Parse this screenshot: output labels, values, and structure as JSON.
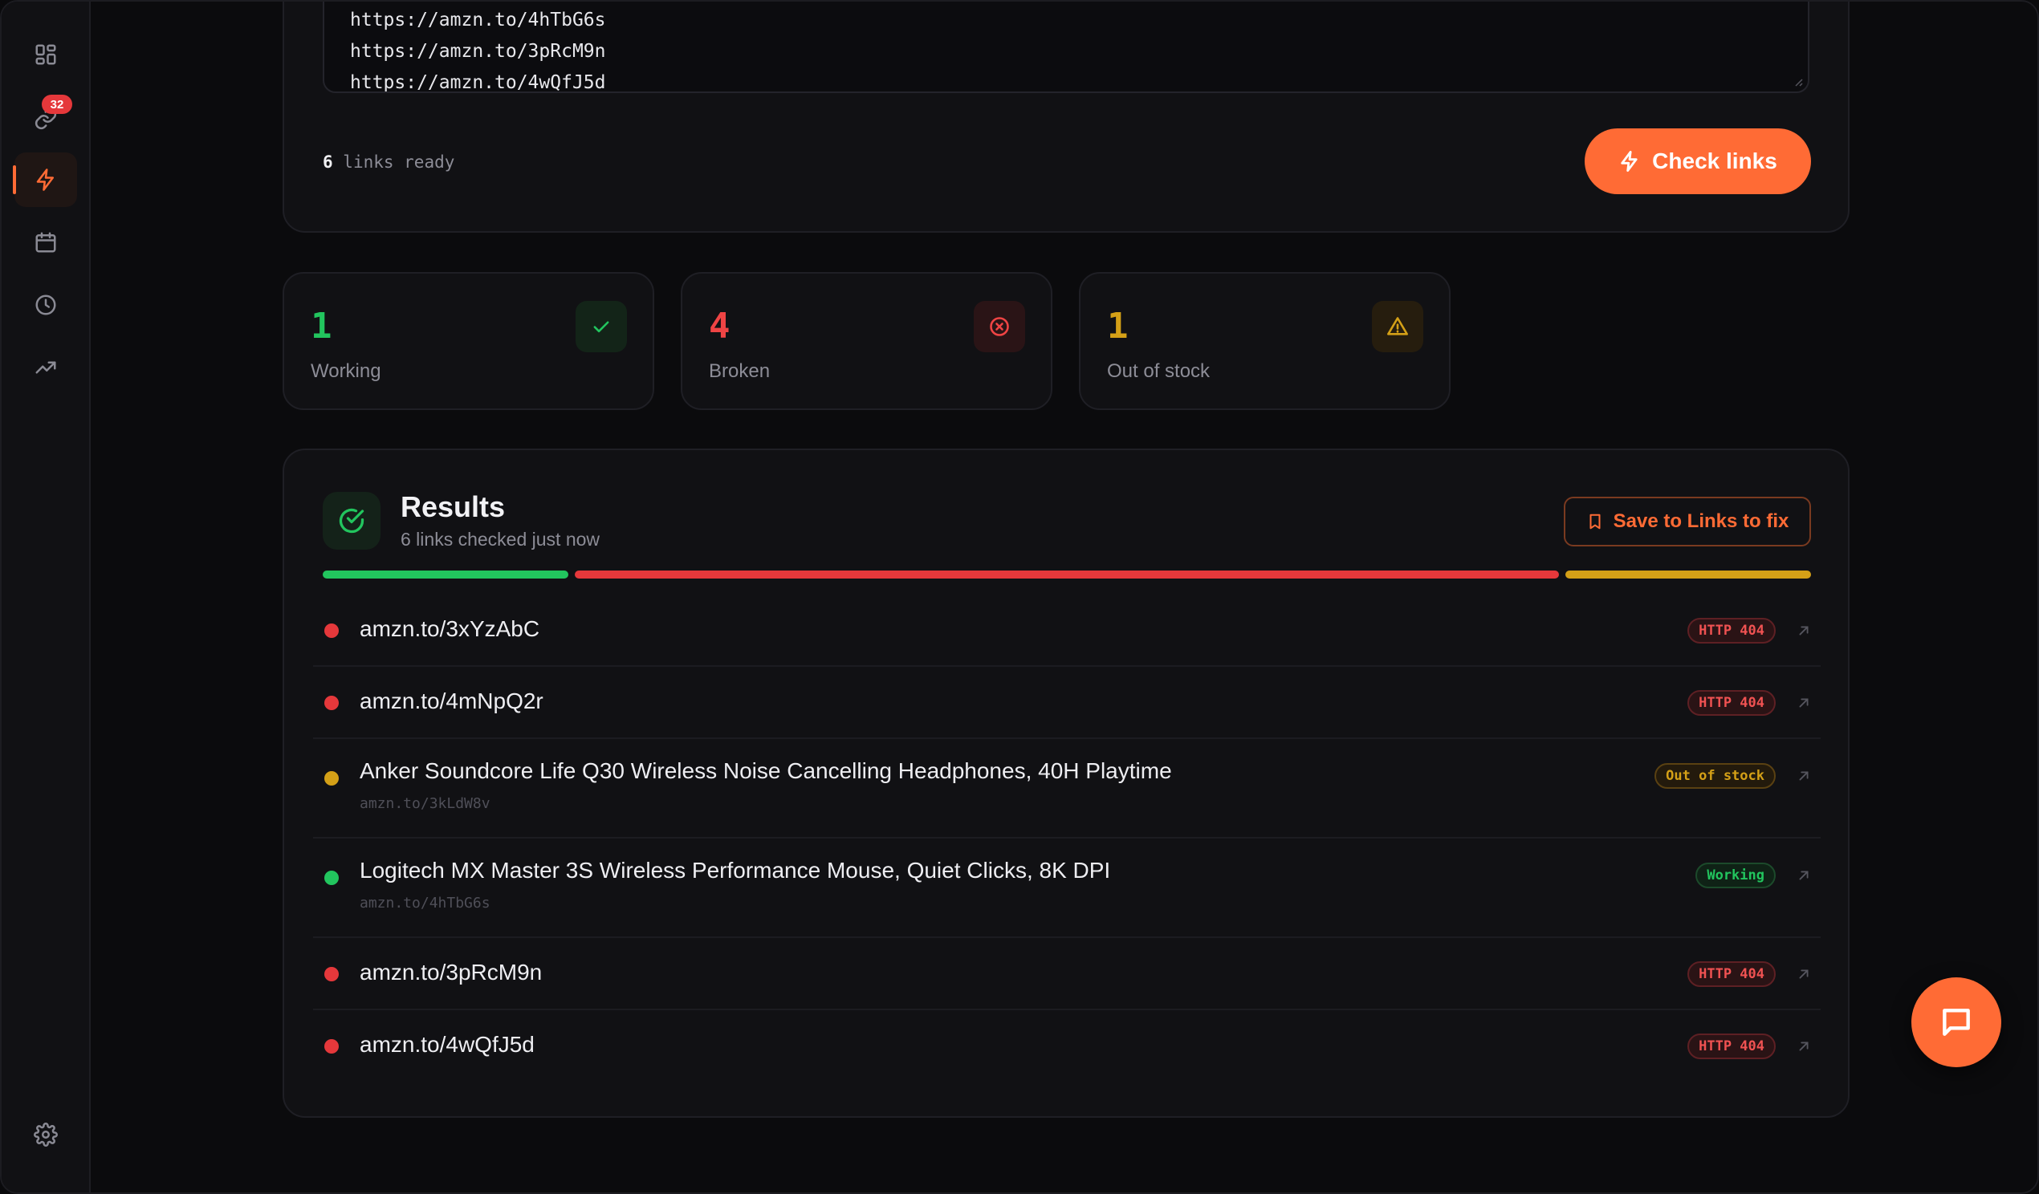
{
  "sidebar": {
    "items": [
      {
        "icon": "dashboard-icon"
      },
      {
        "icon": "link-icon",
        "badge": "32"
      },
      {
        "icon": "lightning-icon",
        "active": true
      },
      {
        "icon": "calendar-icon"
      },
      {
        "icon": "clock-icon"
      },
      {
        "icon": "trending-up-icon"
      }
    ],
    "settings_icon": "gear-icon"
  },
  "input": {
    "lines": [
      "https://amzn.to/4hTbG6s",
      "https://amzn.to/3pRcM9n",
      "https://amzn.to/4wQfJ5d"
    ],
    "count": "6",
    "count_suffix": " links ready",
    "check_button": "Check links"
  },
  "stats": [
    {
      "value": "1",
      "label": "Working",
      "color": "#22c55e",
      "icon": "check-icon"
    },
    {
      "value": "4",
      "label": "Broken",
      "color": "#ef4444",
      "icon": "x-circle-icon"
    },
    {
      "value": "1",
      "label": "Out of stock",
      "color": "#d4a017",
      "icon": "warning-icon"
    }
  ],
  "results": {
    "title": "Results",
    "subtitle": "6 links checked just now",
    "save_button": "Save to Links to fix",
    "bar": {
      "working": 1,
      "broken": 4,
      "out_of_stock": 1
    },
    "rows": [
      {
        "title": "amzn.to/3xYzAbC",
        "sub": "",
        "status": "HTTP 404",
        "tone": "red"
      },
      {
        "title": "amzn.to/4mNpQ2r",
        "sub": "",
        "status": "HTTP 404",
        "tone": "red"
      },
      {
        "title": "Anker Soundcore Life Q30 Wireless Noise Cancelling Headphones, 40H Playtime",
        "sub": "amzn.to/3kLdW8v",
        "status": "Out of stock",
        "tone": "amber"
      },
      {
        "title": "Logitech MX Master 3S Wireless Performance Mouse, Quiet Clicks, 8K DPI",
        "sub": "amzn.to/4hTbG6s",
        "status": "Working",
        "tone": "green"
      },
      {
        "title": "amzn.to/3pRcM9n",
        "sub": "",
        "status": "HTTP 404",
        "tone": "red"
      },
      {
        "title": "amzn.to/4wQfJ5d",
        "sub": "",
        "status": "HTTP 404",
        "tone": "red"
      }
    ]
  },
  "colors": {
    "accent": "#ff6b35",
    "working": "#22c55e",
    "broken": "#e5383b",
    "out_of_stock": "#d4a017"
  }
}
